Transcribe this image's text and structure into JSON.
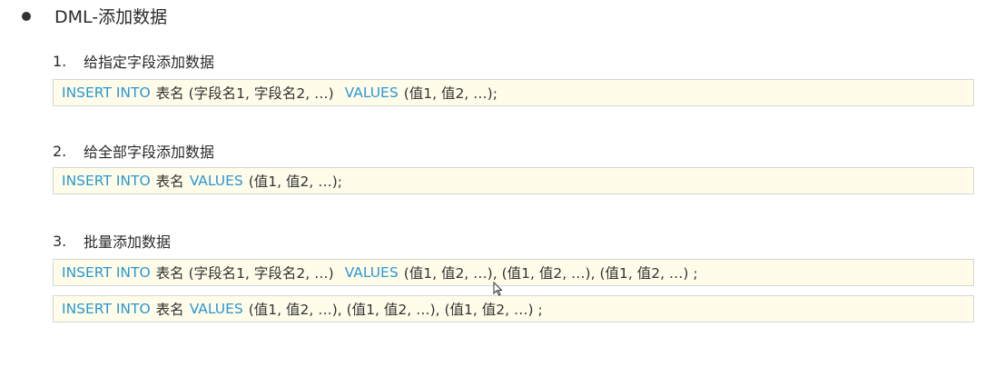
{
  "heading": "DML-添加数据",
  "sections": [
    {
      "number": "1.",
      "title": "给指定字段添加数据",
      "codes": [
        [
          {
            "kw": "INSERT INTO"
          },
          {
            "t": "表名 (字段名1, 字段名2, …)"
          },
          {
            "kw": "VALUES"
          },
          {
            "t": "(值1, 值2, …);"
          }
        ]
      ]
    },
    {
      "number": "2.",
      "title": "给全部字段添加数据",
      "codes": [
        [
          {
            "kw": "INSERT INTO"
          },
          {
            "t": "表名"
          },
          {
            "kw": "VALUES"
          },
          {
            "t": "(值1, 值2, …);"
          }
        ]
      ]
    },
    {
      "number": "3.",
      "title": "批量添加数据",
      "codes": [
        [
          {
            "kw": "INSERT INTO"
          },
          {
            "t": "表名 (字段名1, 字段名2, …)"
          },
          {
            "kw": "VALUES"
          },
          {
            "t": "(值1, 值2, …), (值1, 值2, …), (值1, 值2, …) ;"
          }
        ],
        [
          {
            "kw": "INSERT INTO"
          },
          {
            "t": "表名"
          },
          {
            "kw": "VALUES"
          },
          {
            "t": "(值1, 值2, …), (值1, 值2, …), (值1, 值2, …) ;"
          }
        ]
      ]
    }
  ],
  "colors": {
    "keyword": "#2a97d4",
    "code_background": "#fffdea",
    "code_border": "#d6d6d6"
  }
}
